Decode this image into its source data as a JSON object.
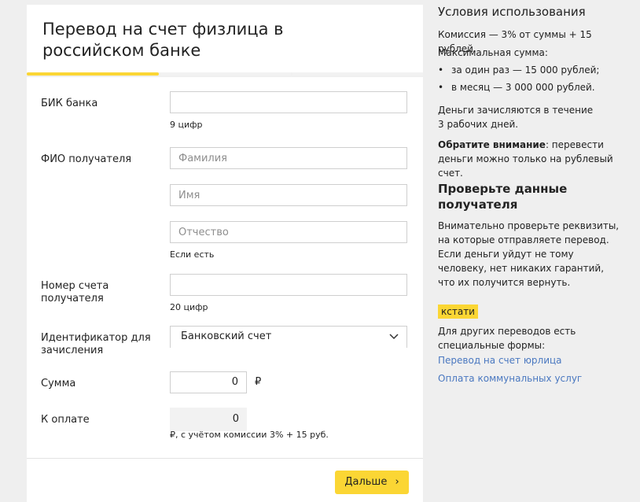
{
  "form": {
    "title": "Перевод на счет физлица в российском банке",
    "progress": 0.35,
    "bik": {
      "label": "БИК банка",
      "value": "",
      "hint": "9 цифр"
    },
    "fio": {
      "label": "ФИО получателя",
      "last_name_placeholder": "Фамилия",
      "first_name_placeholder": "Имя",
      "patronymic_placeholder": "Отчество",
      "patronymic_hint": "Если есть"
    },
    "account": {
      "label": "Номер счета получателя",
      "value": "",
      "hint": "20 цифр"
    },
    "identifier": {
      "label": "Идентификатор для зачисления",
      "selected": "Банковский счет"
    },
    "amount": {
      "label": "Сумма",
      "value": "0",
      "currency": "₽"
    },
    "to_pay": {
      "label": "К оплате",
      "value": "0",
      "note": "₽, с учётом комиссии 3% + 15 руб."
    },
    "next_button": "Дальше",
    "next_icon": "chevron-right-icon",
    "accent_color": "#fbd634"
  },
  "sidebar": {
    "title": "Условия использования",
    "commission": "Комиссия — 3% от суммы + 15 рублей.",
    "max_sum": "Максимальная сумма:",
    "limits": [
      "за один раз — 15 000 рублей;",
      "в месяц — 3 000 000 рублей."
    ],
    "timing": "Деньги зачисляются в течение 3 рабочих дней.",
    "note_bold": "Обратите внимание",
    "note_text": ": перевести деньги можно только на рублевый счет.",
    "check_title": "Проверьте данные получателя",
    "check_text": "Внимательно проверьте реквизиты, на которые отправляете перевод. Если деньги уйдут не тому человеку, нет никаких гарантий, что их получится вернуть.",
    "badge": "кстати",
    "other_text": "Для других переводов есть специальные формы:",
    "links": [
      "Перевод на счет юрлица",
      "Оплата коммунальных услуг"
    ],
    "link_color": "#4a78c0"
  }
}
